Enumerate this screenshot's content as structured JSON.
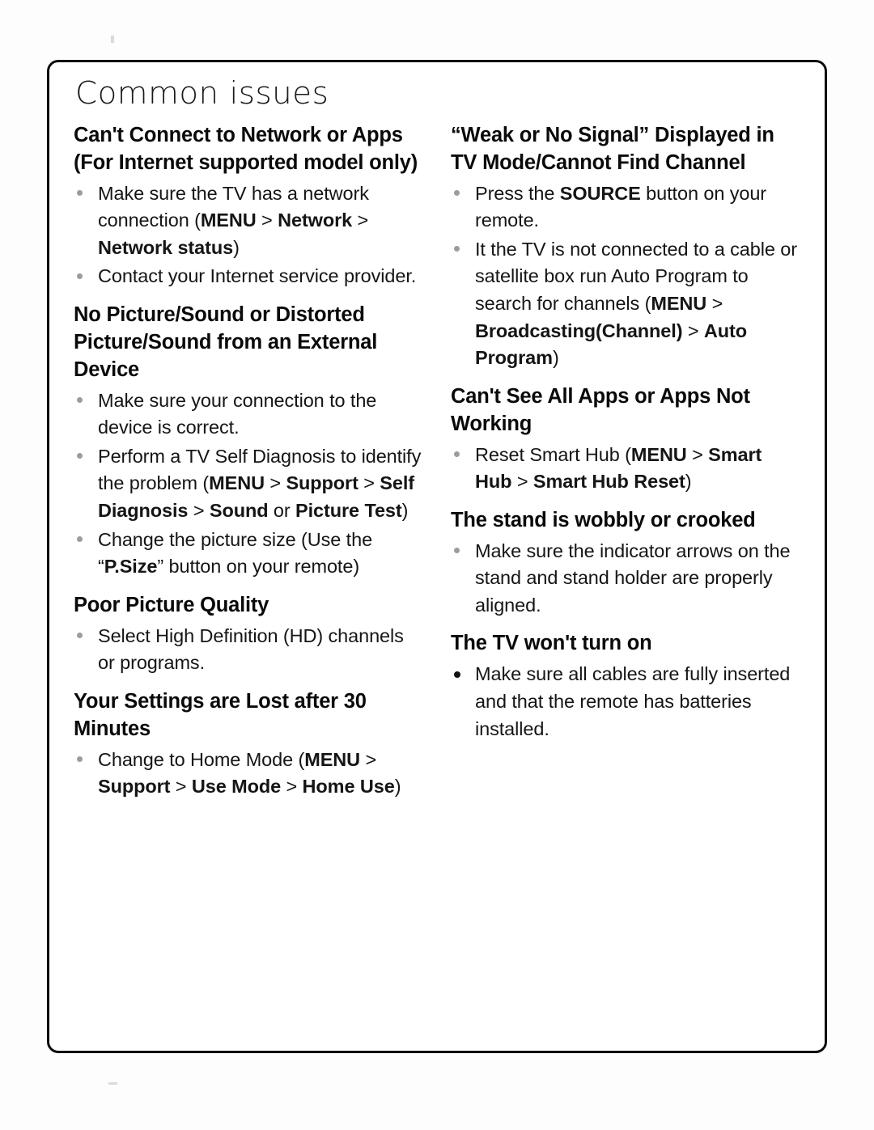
{
  "document": {
    "title": "Common issues",
    "left_column": [
      {
        "heading": "Can't Connect to Network or Apps (For Internet supported model only)",
        "bullets": [
          {
            "parts": [
              {
                "t": "Make sure the TV has a network connection (",
                "b": false
              },
              {
                "t": "MENU",
                "b": true
              },
              {
                "t": " > ",
                "b": false
              },
              {
                "t": "Network",
                "b": true
              },
              {
                "t": " > ",
                "b": false
              },
              {
                "t": "Network status",
                "b": true
              },
              {
                "t": ")",
                "b": false
              }
            ]
          },
          {
            "parts": [
              {
                "t": "Contact your Internet service provider.",
                "b": false
              }
            ]
          }
        ]
      },
      {
        "heading": "No Picture/Sound or Distorted Picture/Sound from an External Device",
        "bullets": [
          {
            "parts": [
              {
                "t": "Make sure your connection to the device is correct.",
                "b": false
              }
            ]
          },
          {
            "parts": [
              {
                "t": "Perform a TV Self Diagnosis to identify the problem (",
                "b": false
              },
              {
                "t": "MENU",
                "b": true
              },
              {
                "t": " > ",
                "b": false
              },
              {
                "t": "Support",
                "b": true
              },
              {
                "t": " > ",
                "b": false
              },
              {
                "t": "Self Diagnosis",
                "b": true
              },
              {
                "t": " > ",
                "b": false
              },
              {
                "t": "Sound",
                "b": true
              },
              {
                "t": " or ",
                "b": false
              },
              {
                "t": "Picture Test",
                "b": true
              },
              {
                "t": ")",
                "b": false
              }
            ]
          },
          {
            "parts": [
              {
                "t": "Change the picture size (Use the “",
                "b": false
              },
              {
                "t": "P.Size",
                "b": true
              },
              {
                "t": "” button on your remote)",
                "b": false
              }
            ]
          }
        ]
      },
      {
        "heading": "Poor Picture Quality",
        "bullets": [
          {
            "parts": [
              {
                "t": "Select High Definition (HD) channels or programs.",
                "b": false
              }
            ]
          }
        ]
      },
      {
        "heading": "Your Settings are Lost after 30 Minutes",
        "bullets": [
          {
            "parts": [
              {
                "t": "Change to Home Mode (",
                "b": false
              },
              {
                "t": "MENU",
                "b": true
              },
              {
                "t": " > ",
                "b": false
              },
              {
                "t": "Support",
                "b": true
              },
              {
                "t": " > ",
                "b": false
              },
              {
                "t": "Use Mode",
                "b": true
              },
              {
                "t": " > ",
                "b": false
              },
              {
                "t": "Home Use",
                "b": true
              },
              {
                "t": ")",
                "b": false
              }
            ]
          }
        ]
      }
    ],
    "right_column": [
      {
        "heading": "“Weak or No Signal” Displayed in TV Mode/Cannot Find Channel",
        "bullets": [
          {
            "parts": [
              {
                "t": "Press the ",
                "b": false
              },
              {
                "t": "SOURCE",
                "b": true
              },
              {
                "t": " button on your remote.",
                "b": false
              }
            ]
          },
          {
            "parts": [
              {
                "t": "It the TV is not connected to a cable or satellite box run Auto Program to search for channels (",
                "b": false
              },
              {
                "t": "MENU",
                "b": true
              },
              {
                "t": " > ",
                "b": false
              },
              {
                "t": "Broadcasting(Channel)",
                "b": true
              },
              {
                "t": " > ",
                "b": false
              },
              {
                "t": "Auto Program",
                "b": true
              },
              {
                "t": ")",
                "b": false
              }
            ]
          }
        ]
      },
      {
        "heading": "Can't See All Apps or Apps Not Working",
        "bullets": [
          {
            "parts": [
              {
                "t": "Reset Smart Hub (",
                "b": false
              },
              {
                "t": "MENU",
                "b": true
              },
              {
                "t": " > ",
                "b": false
              },
              {
                "t": "Smart Hub",
                "b": true
              },
              {
                "t": " > ",
                "b": false
              },
              {
                "t": "Smart Hub Reset",
                "b": true
              },
              {
                "t": ")",
                "b": false
              }
            ]
          }
        ]
      },
      {
        "heading": "The stand is wobbly or crooked",
        "bullets": [
          {
            "parts": [
              {
                "t": "Make sure the indicator arrows on the stand and stand holder are properly aligned.",
                "b": false
              }
            ]
          }
        ]
      },
      {
        "heading": "The TV won't turn on",
        "bullets": [
          {
            "solid": true,
            "parts": [
              {
                "t": "Make sure all cables are fully inserted and that the remote has batteries installed.",
                "b": false
              }
            ]
          }
        ]
      }
    ]
  },
  "colors": {
    "page_background": "#fdfdfd",
    "frame_background": "#ffffff",
    "frame_border": "#0d0d0d",
    "text": "#111111",
    "bullet_faded": "#4a4a4a",
    "bullet_solid": "#111111"
  }
}
